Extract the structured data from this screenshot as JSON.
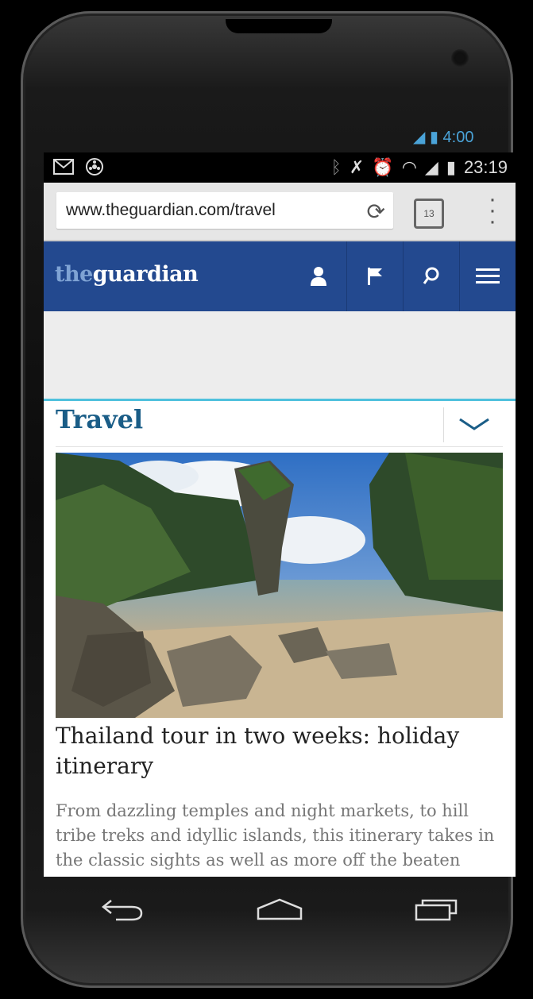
{
  "phone_status": {
    "time_outer": "4:00"
  },
  "status_bar": {
    "time": "23:19",
    "left_icons": [
      "gmail-icon",
      "tools-icon"
    ],
    "right_icons": [
      "bluetooth-icon",
      "mute-icon",
      "alarm-icon",
      "wifi-icon",
      "signal-icon",
      "battery-icon"
    ]
  },
  "browser": {
    "url": "www.theguardian.com/travel",
    "tab_count": "13"
  },
  "site_header": {
    "logo_the": "the",
    "logo_guardian": "guardian",
    "icons": [
      "profile-icon",
      "edition-flag-icon",
      "search-icon",
      "menu-icon"
    ]
  },
  "section": {
    "title": "Travel"
  },
  "article": {
    "headline": "Thailand tour in two weeks: holiday itinerary",
    "standfirst": "From dazzling temples and night markets, to hill tribe treks and idyllic islands, this itinerary takes in the classic sights as well as more off the beaten track"
  },
  "nav_bar": {
    "buttons": [
      "back-icon",
      "home-icon",
      "recent-apps-icon"
    ]
  }
}
